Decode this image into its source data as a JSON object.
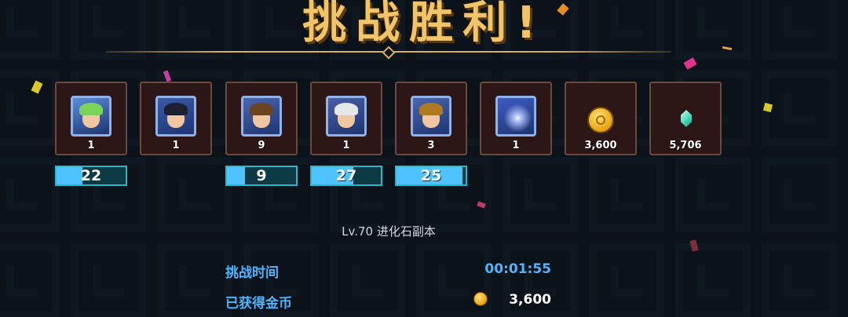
{
  "title": "挑战胜利!",
  "dungeon": "Lv.70  进化石副本",
  "rewards": [
    {
      "type": "hero",
      "qty": "1",
      "hair": "#7bd35a",
      "bg": "#5a8bd9"
    },
    {
      "type": "hero",
      "qty": "1",
      "hair": "#1c2030",
      "bg": "#3a5aa8"
    },
    {
      "type": "hero",
      "qty": "9",
      "hair": "#6a4420",
      "bg": "#4a66b0"
    },
    {
      "type": "hero",
      "qty": "1",
      "hair": "#e6e6e6",
      "bg": "#4a5fa6"
    },
    {
      "type": "hero",
      "qty": "3",
      "hair": "#b07a22",
      "bg": "#4a66b0"
    },
    {
      "type": "evolution-stone",
      "qty": "1",
      "bg": "#3d5cc4"
    },
    {
      "type": "gold",
      "qty": "3,600"
    },
    {
      "type": "crystal",
      "qty": "5,706"
    }
  ],
  "progress": [
    {
      "value": "22",
      "fill": 0.38
    },
    {
      "value": "9",
      "fill": 0.26
    },
    {
      "value": "27",
      "fill": 0.6
    },
    {
      "value": "25",
      "fill": 0.95
    }
  ],
  "stats": {
    "time_label": "挑战时间",
    "time_value": "00:01:55",
    "gold_label": "已获得金币",
    "gold_value": "3,600"
  },
  "colors": {
    "title": "#f1c46a",
    "stat_label": "#52b4ff",
    "time_value": "#52b4ff",
    "gold_value": "#ffffff"
  }
}
